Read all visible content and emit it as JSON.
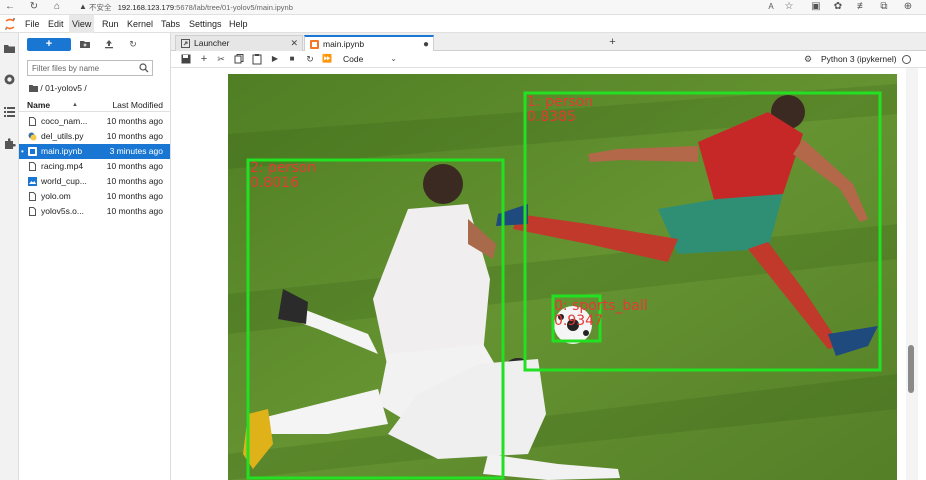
{
  "browser": {
    "security_label": "不安全",
    "url_host": "192.168.123.179",
    "url_path": ":5678/lab/tree/01-yolov5/main.ipynb",
    "icons": [
      "back-icon",
      "refresh-icon",
      "home-icon",
      "warning-icon",
      "read-aloud-icon",
      "favorite-icon",
      "split-icon",
      "extensions-icon",
      "favorites-icon",
      "collections-icon",
      "profile-icon"
    ]
  },
  "menu": {
    "items": [
      "File",
      "Edit",
      "View",
      "Run",
      "Kernel",
      "Tabs",
      "Settings",
      "Help"
    ],
    "active": "View"
  },
  "file_browser": {
    "new_button_label": "+",
    "filter_placeholder": "Filter files by name",
    "breadcrumb": "/ 01-yolov5 /",
    "col_name": "Name",
    "col_modified": "Last Modified",
    "files": [
      {
        "name": "coco_nam...",
        "modified": "10 months ago",
        "icon": "file-icon",
        "selected": false
      },
      {
        "name": "del_utils.py",
        "modified": "10 months ago",
        "icon": "python-file-icon",
        "selected": false
      },
      {
        "name": "main.ipynb",
        "modified": "3 minutes ago",
        "icon": "notebook-icon",
        "selected": true,
        "running": true
      },
      {
        "name": "racing.mp4",
        "modified": "10 months ago",
        "icon": "file-icon",
        "selected": false
      },
      {
        "name": "world_cup...",
        "modified": "10 months ago",
        "icon": "image-file-icon",
        "selected": false
      },
      {
        "name": "yolo.om",
        "modified": "10 months ago",
        "icon": "file-icon",
        "selected": false
      },
      {
        "name": "yolov5s.o...",
        "modified": "10 months ago",
        "icon": "file-icon",
        "selected": false
      }
    ]
  },
  "tabs": [
    {
      "label": "Launcher",
      "active": false
    },
    {
      "label": "main.ipynb",
      "active": true
    }
  ],
  "toolbar": {
    "cell_type": "Code",
    "kernel_name": "Python 3 (ipykernel)"
  },
  "detections": [
    {
      "label": "1: person",
      "score": "0.8385"
    },
    {
      "label": "2: person",
      "score": "0.8016"
    },
    {
      "label": "0: sports_ball",
      "score": "0.9347"
    }
  ],
  "colors": {
    "accent": "#1976d2",
    "box": "#22e022",
    "label": "#e53935",
    "grass": "#5d8a2e"
  }
}
